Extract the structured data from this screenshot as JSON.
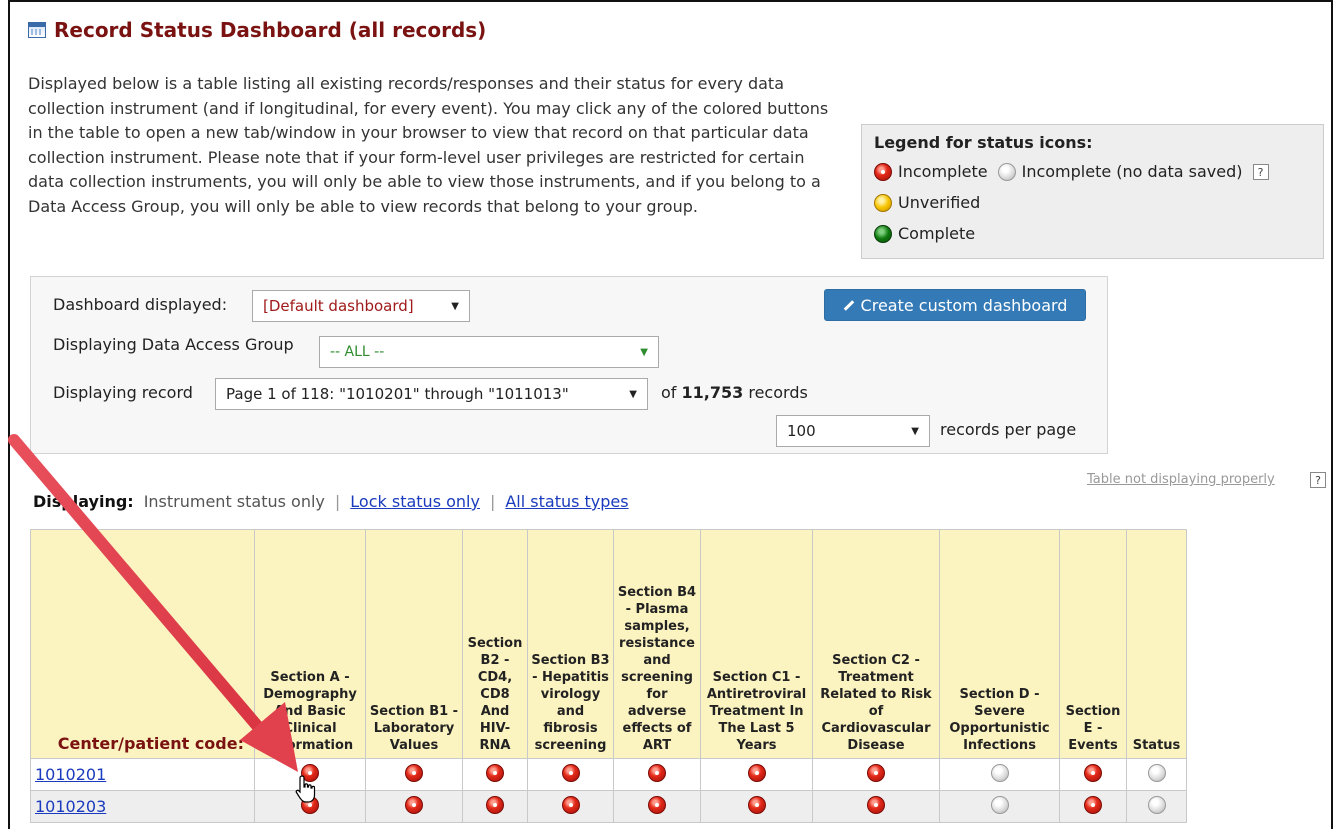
{
  "page": {
    "title": "Record Status Dashboard (all records)",
    "intro": "Displayed below is a table listing all existing records/responses and their status for every data collection instrument (and if longitudinal, for every event). You may click any of the colored buttons in the table to open a new tab/window in your browser to view that record on that particular data collection instrument. Please note that if your form-level user privileges are restricted for certain data collection instruments, you will only be able to view those instruments, and if you belong to a Data Access Group, you will only be able to view records that belong to your group."
  },
  "legend": {
    "title": "Legend for status icons:",
    "incomplete": "Incomplete",
    "incomplete_no_data": "Incomplete (no data saved)",
    "unverified": "Unverified",
    "complete": "Complete",
    "help": "?"
  },
  "controls": {
    "dashboard_label": "Dashboard displayed:",
    "dashboard_value": "[Default dashboard]",
    "create_button": "Create custom dashboard",
    "dag_label": "Displaying Data Access Group",
    "dag_value": "-- ALL --",
    "record_label": "Displaying record",
    "record_value": "Page 1 of 118: \"1010201\" through \"1011013\"",
    "of_text": "of",
    "record_count": "11,753",
    "records_text": "records",
    "per_page_value": "100",
    "per_page_label": "records per page"
  },
  "table_help": {
    "link": "Table not displaying properly",
    "help": "?"
  },
  "displaying": {
    "label": "Displaying:",
    "current": "Instrument status only",
    "lock": "Lock status only",
    "all": "All status types"
  },
  "table": {
    "first_header": "Center/patient code:",
    "columns": [
      "Section A - Demography And Basic Clinical Information",
      "Section B1 - Laboratory Values",
      "Section B2 - CD4, CD8 And HIV-RNA",
      "Section B3 - Hepatitis virology and fibrosis screening",
      "Section B4 - Plasma samples, resistance and screening for adverse effects of ART",
      "Section C1 - Antiretroviral Treatment In The Last 5 Years",
      "Section C2 - Treatment Related to Risk of Cardiovascular Disease",
      "Section D - Severe Opportunistic Infections",
      "Section E - Events",
      "Status"
    ],
    "rows": [
      {
        "code": "1010201",
        "statuses": [
          "red",
          "red",
          "red",
          "red",
          "red",
          "red",
          "red",
          "gray",
          "red",
          "gray"
        ]
      },
      {
        "code": "1010203",
        "statuses": [
          "red",
          "red",
          "red",
          "red",
          "red",
          "red",
          "red",
          "gray",
          "red",
          "gray"
        ]
      }
    ]
  }
}
